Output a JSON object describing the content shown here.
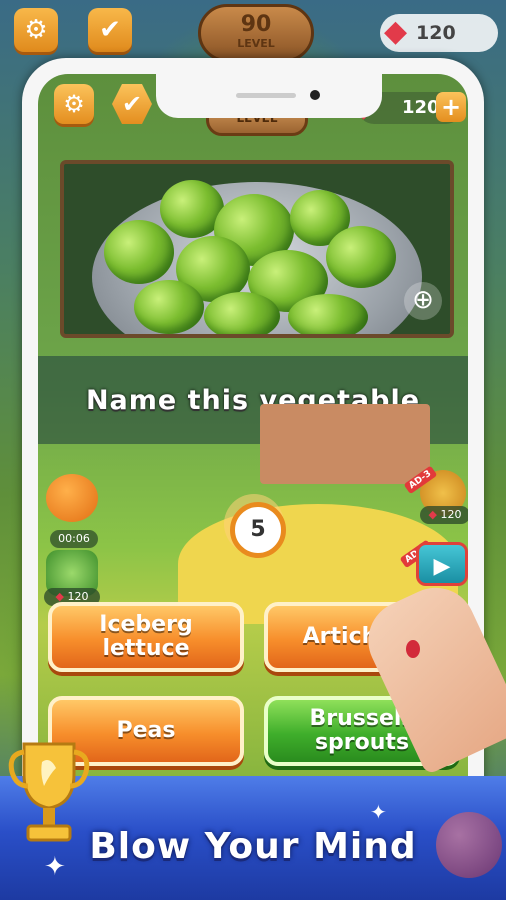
{
  "background": {
    "level_number": "90",
    "level_label": "LEVEL",
    "gems": "120",
    "plus": "+"
  },
  "top_bar": {
    "settings_icon": "gear-icon",
    "check_icon": "check-icon",
    "level_label": "LEVEL",
    "gems": "120",
    "plus": "+"
  },
  "question": "Name this vegetable",
  "power_ups": {
    "left_timer": "00:06",
    "left_price": "120",
    "right_price": "120",
    "ad_tag_1": "AD-3",
    "ad_tag_2": "AD-3"
  },
  "countdown": "5",
  "answers": [
    {
      "label": "Iceberg lettuce",
      "color": "orange"
    },
    {
      "label": "Artichoke",
      "color": "orange"
    },
    {
      "label": "Peas",
      "color": "orange"
    },
    {
      "label": "Brussels sprouts",
      "color": "green"
    }
  ],
  "banner": {
    "tagline": "Blow Your Mind"
  },
  "colors": {
    "orange_button": "#f78e2b",
    "green_button": "#3fae2b",
    "banner_blue": "#2a4fc8",
    "gem_red": "#e23a4a"
  }
}
